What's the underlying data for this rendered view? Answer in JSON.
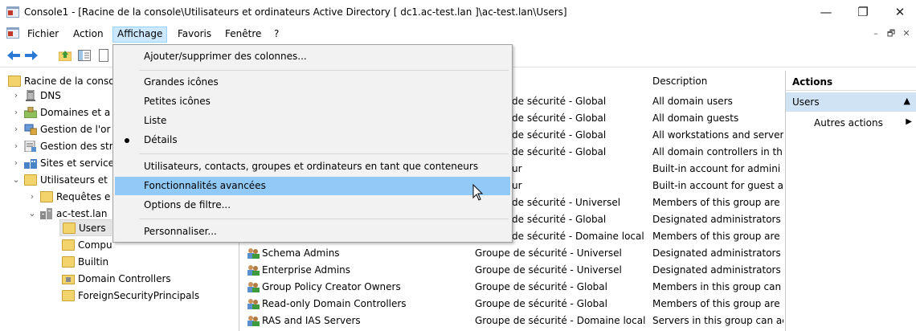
{
  "window": {
    "title": "Console1 - [Racine de la console\\Utilisateurs et ordinateurs Active Directory [ dc1.ac-test.lan ]\\ac-test.lan\\Users]",
    "controls": [
      "—",
      "❐",
      "✕"
    ]
  },
  "menubar": {
    "items": [
      "Fichier",
      "Action",
      "Affichage",
      "Favoris",
      "Fenêtre",
      "?"
    ],
    "active": "Affichage",
    "mdi_controls": [
      "–",
      "🗗",
      "✕"
    ]
  },
  "tree": {
    "nodes": [
      {
        "label": "Racine de la conso",
        "indent": 0,
        "expander": "",
        "icon": "folder-icon"
      },
      {
        "label": "DNS",
        "indent": 1,
        "expander": "›",
        "icon": "dns-icon"
      },
      {
        "label": "Domaines et a",
        "indent": 1,
        "expander": "›",
        "icon": "domains-icon"
      },
      {
        "label": "Gestion de l'or",
        "indent": 1,
        "expander": "›",
        "icon": "computer-mgmt-icon"
      },
      {
        "label": "Gestion des str",
        "indent": 1,
        "expander": "›",
        "icon": "gpo-mgmt-icon"
      },
      {
        "label": "Sites et service",
        "indent": 1,
        "expander": "›",
        "icon": "sites-icon"
      },
      {
        "label": "Utilisateurs et",
        "indent": 1,
        "expander": "⌄",
        "icon": "aduc-icon"
      },
      {
        "label": "Requêtes e",
        "indent": 2,
        "expander": "›",
        "icon": "folder-icon"
      },
      {
        "label": "ac-test.lan",
        "indent": 2,
        "expander": "⌄",
        "icon": "domain-icon"
      },
      {
        "label": "Users",
        "indent": 3,
        "expander": "",
        "icon": "folder-icon",
        "selected": true
      },
      {
        "label": "Compu",
        "indent": 3,
        "expander": "",
        "icon": "folder-icon"
      },
      {
        "label": "Builtin",
        "indent": 3,
        "expander": "",
        "icon": "folder-icon"
      },
      {
        "label": "Domain Controllers",
        "indent": 3,
        "expander": "",
        "icon": "ou-icon"
      },
      {
        "label": "ForeignSecurityPrincipals",
        "indent": 3,
        "expander": "",
        "icon": "folder-icon"
      }
    ]
  },
  "list": {
    "header_description": "Description",
    "rows": [
      {
        "name": "",
        "type": "de sécurité - Global",
        "description": "All domain users"
      },
      {
        "name": "",
        "type": "de sécurité - Global",
        "description": "All domain guests"
      },
      {
        "name": "",
        "type": "de sécurité - Global",
        "description": "All workstations and server"
      },
      {
        "name": "",
        "type": "de sécurité - Global",
        "description": "All domain controllers in th"
      },
      {
        "name": "",
        "type": "ur",
        "description": "Built-in account for admini"
      },
      {
        "name": "",
        "type": "ur",
        "description": "Built-in account for guest a"
      },
      {
        "name": "",
        "type": "de sécurité - Universel",
        "description": "Members of this group are"
      },
      {
        "name": "",
        "type": "de sécurité - Global",
        "description": "Designated administrators"
      },
      {
        "name": "",
        "type": "de sécurité - Domaine local",
        "description": "Members of this group are"
      },
      {
        "name": "Schema Admins",
        "type": "Groupe de sécurité - Universel",
        "description": "Designated administrators"
      },
      {
        "name": "Enterprise Admins",
        "type": "Groupe de sécurité - Universel",
        "description": "Designated administrators"
      },
      {
        "name": "Group Policy Creator Owners",
        "type": "Groupe de sécurité - Global",
        "description": "Members in this group can"
      },
      {
        "name": "Read-only Domain Controllers",
        "type": "Groupe de sécurité - Global",
        "description": "Members of this group are"
      },
      {
        "name": "RAS and IAS Servers",
        "type": "Groupe de sécurité - Domaine local",
        "description": "Servers in this group can ac"
      }
    ]
  },
  "actions": {
    "header": "Actions",
    "section": "Users",
    "item": "Autres actions"
  },
  "menu": {
    "items": [
      {
        "label": "Ajouter/supprimer des colonnes..."
      },
      {
        "label": "Grandes icônes"
      },
      {
        "label": "Petites icônes"
      },
      {
        "label": "Liste"
      },
      {
        "label": "Détails",
        "checked": true
      },
      {
        "label": "Utilisateurs, contacts, groupes et ordinateurs en tant que conteneurs"
      },
      {
        "label": "Fonctionnalités avancées",
        "highlighted": true
      },
      {
        "label": "Options de filtre..."
      },
      {
        "label": "Personnaliser..."
      }
    ]
  }
}
